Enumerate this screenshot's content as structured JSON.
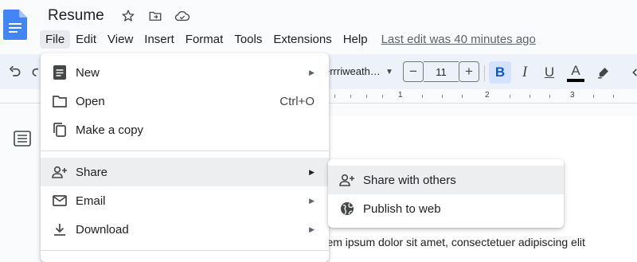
{
  "app": {
    "doc_title": "Resume",
    "last_edit": "Last edit was 40 minutes ago"
  },
  "menubar": {
    "items": [
      "File",
      "Edit",
      "View",
      "Insert",
      "Format",
      "Tools",
      "Extensions",
      "Help"
    ],
    "active": "File"
  },
  "toolbar": {
    "font_name": "errriweath…",
    "font_size": "11",
    "minus": "−",
    "plus": "+",
    "bold": "B",
    "italic": "I",
    "underline": "U",
    "text_color": "A",
    "text_color_value": "#000000"
  },
  "ruler": {
    "numbers": [
      "1",
      "2",
      "3"
    ]
  },
  "document": {
    "visible_text": "orem ipsum dolor sit amet, consectetuer adipiscing elit"
  },
  "file_menu": {
    "items": [
      {
        "label": "New",
        "icon": "new-doc-icon",
        "shortcut": "",
        "submenu": true
      },
      {
        "label": "Open",
        "icon": "folder-icon",
        "shortcut": "Ctrl+O",
        "submenu": false
      },
      {
        "label": "Make a copy",
        "icon": "copy-icon",
        "shortcut": "",
        "submenu": false
      },
      {
        "label": "Share",
        "icon": "person-add-icon",
        "shortcut": "",
        "submenu": true,
        "highlighted": true
      },
      {
        "label": "Email",
        "icon": "mail-icon",
        "shortcut": "",
        "submenu": true
      },
      {
        "label": "Download",
        "icon": "download-icon",
        "shortcut": "",
        "submenu": true
      }
    ]
  },
  "share_submenu": {
    "items": [
      {
        "label": "Share with others",
        "icon": "person-add-icon",
        "highlighted": true
      },
      {
        "label": "Publish to web",
        "icon": "globe-icon"
      }
    ]
  },
  "colors": {
    "accent": "#0b57d0",
    "bold_bg": "#d3e3fd",
    "toolbar_bg": "#edf2fa",
    "docs_blue": "#4285f4"
  }
}
